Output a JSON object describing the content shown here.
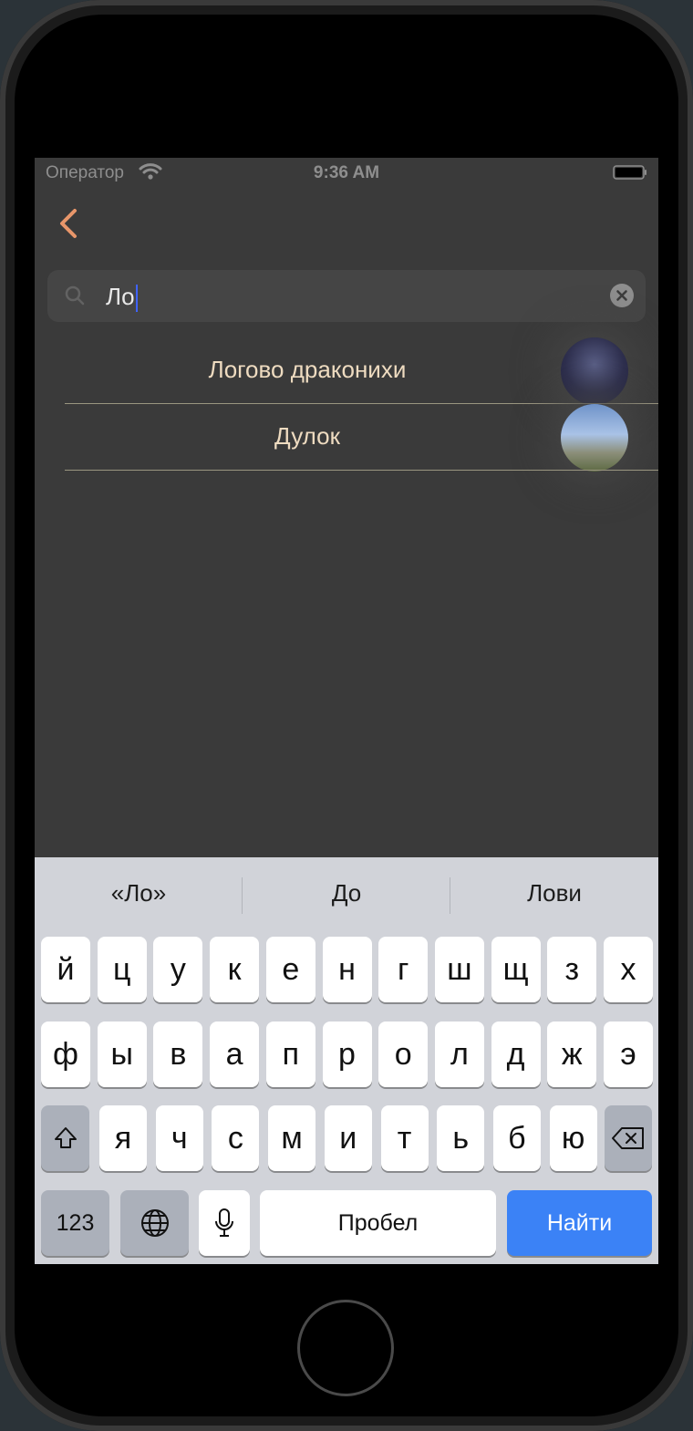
{
  "status_bar": {
    "carrier": "Оператор",
    "time": "9:36 AM"
  },
  "search": {
    "value": "Ло"
  },
  "results": [
    {
      "label": "Логово драконихи"
    },
    {
      "label": "Дулок"
    }
  ],
  "keyboard": {
    "suggestions": [
      "«Ло»",
      "До",
      "Лови"
    ],
    "row1": [
      "й",
      "ц",
      "у",
      "к",
      "е",
      "н",
      "г",
      "ш",
      "щ",
      "з",
      "х"
    ],
    "row2": [
      "ф",
      "ы",
      "в",
      "а",
      "п",
      "р",
      "о",
      "л",
      "д",
      "ж",
      "э"
    ],
    "row3": [
      "я",
      "ч",
      "с",
      "м",
      "и",
      "т",
      "ь",
      "б",
      "ю"
    ],
    "numbers_label": "123",
    "space_label": "Пробел",
    "go_label": "Найти"
  },
  "colors": {
    "accent": "#e8966a",
    "go_button": "#3b82f6",
    "result_text": "#eedbc0"
  }
}
